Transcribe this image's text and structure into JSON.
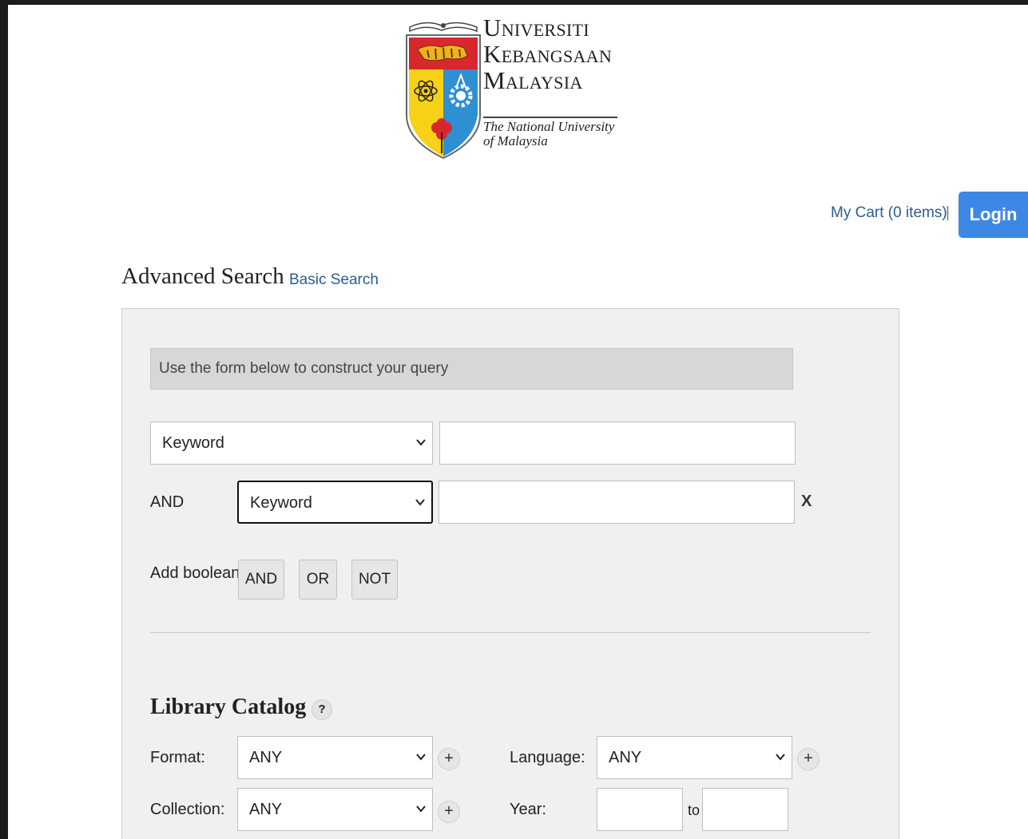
{
  "logo": {
    "line1_cap": "U",
    "line1_rest": "NIVERSITI",
    "line2_cap": "K",
    "line2_rest": "EBANGSAAN",
    "line3_cap": "M",
    "line3_rest": "ALAYSIA",
    "sub1": "The National University",
    "sub2": "of Malaysia"
  },
  "header": {
    "cart_label": "My Cart (0 items)",
    "separator": "|",
    "login_label": "Login"
  },
  "page": {
    "title": "Advanced Search",
    "basic_search_link": "Basic Search"
  },
  "query_form": {
    "info_text": "Use the form below to construct your query",
    "row1": {
      "field": "Keyword",
      "value": ""
    },
    "row2": {
      "operator": "AND",
      "field": "Keyword",
      "value": "",
      "remove_label": "X"
    },
    "add_boolean_label": "Add boolean:",
    "boolean_buttons": [
      "AND",
      "OR",
      "NOT"
    ]
  },
  "library_catalog": {
    "title": "Library Catalog",
    "help_label": "?",
    "format_label": "Format:",
    "format_value": "ANY",
    "collection_label": "Collection:",
    "collection_value": "ANY",
    "language_label": "Language:",
    "language_value": "ANY",
    "year_label": "Year:",
    "year_to_label": "to",
    "year_from": "",
    "year_to": "",
    "plus_label": "+"
  },
  "colors": {
    "login_bg": "#3d87e6",
    "link": "#2a5d8f",
    "panel_bg": "#f0f0f0",
    "crest_red": "#d9272e",
    "crest_blue": "#2e8fd3",
    "crest_yellow": "#f7d117"
  }
}
